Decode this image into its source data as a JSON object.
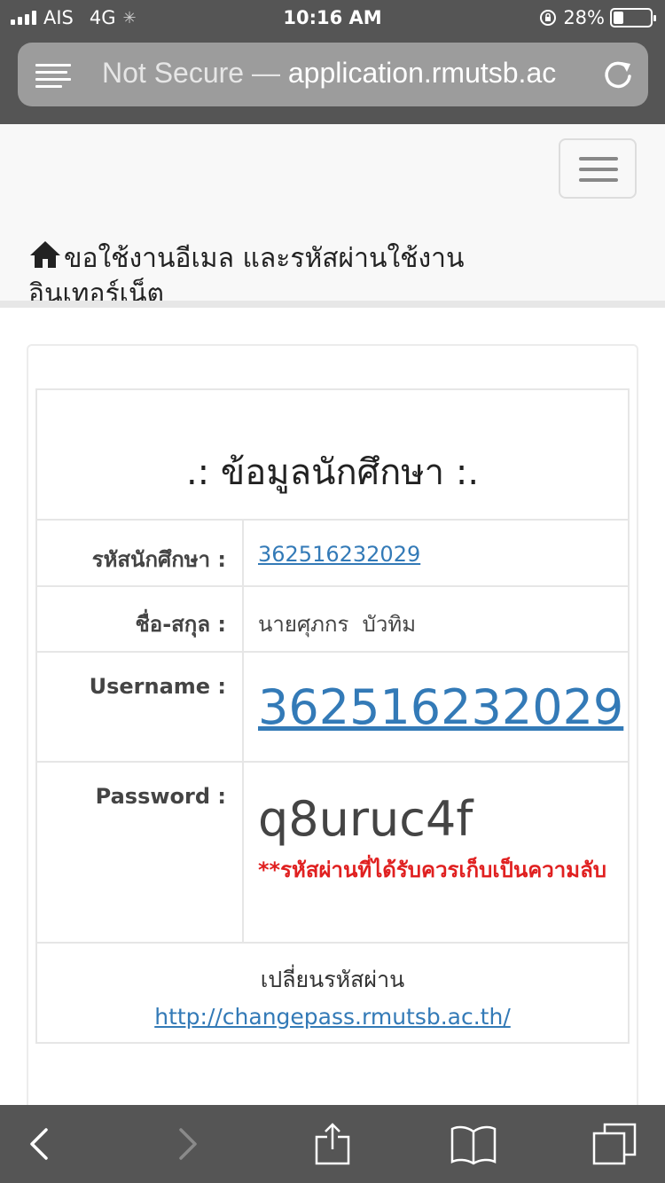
{
  "status_bar": {
    "carrier": "AIS",
    "network": "4G",
    "time": "10:16 AM",
    "battery_percent": "28%",
    "battery_level": 0.28
  },
  "browser": {
    "url_prefix": "Not Secure —",
    "url": "application.rmutsb.ac",
    "icons": [
      "reader-icon",
      "reload-icon"
    ]
  },
  "navbar": {
    "brand_line1": "ขอใช้งานอีเมล และรหัสผ่านใช้งาน",
    "brand_line2": "อินเทอร์เน็ต",
    "brand_icon": "home-icon"
  },
  "student": {
    "title": ".: ข้อมูลนักศึกษา :.",
    "id_label": "รหัสนักศึกษา :",
    "id_value": "362516232029",
    "name_label": "ชื่อ-สกุล :",
    "name_value": "นายศุภกร  บัวทิม",
    "username_label": "Username :",
    "username_value": "362516232029",
    "password_label": "Password :",
    "password_value": "q8uruc4f",
    "password_warning": "**รหัสผ่านที่ได้รับควรเก็บเป็นความลับ",
    "change_label": "เปลี่ยนรหัสผ่าน",
    "change_link": "http://changepass.rmutsb.ac.th/"
  },
  "toolbar": {
    "icons": [
      "back-icon",
      "forward-icon",
      "share-icon",
      "bookmarks-icon",
      "tabs-icon"
    ]
  },
  "colors": {
    "chrome": "#555555",
    "link": "#337ab7",
    "warning": "#e02020",
    "navbar_bg": "#f8f8f8"
  }
}
